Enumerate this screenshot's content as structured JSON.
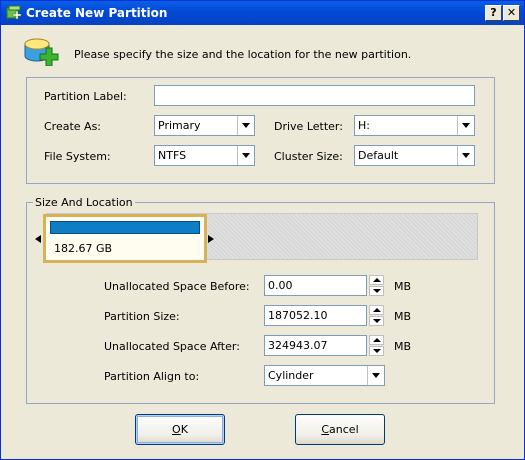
{
  "window": {
    "title": "Create New Partition",
    "help_label": "?",
    "close_label": "✕"
  },
  "header": {
    "text": "Please specify the size and the location for the new partition."
  },
  "form": {
    "partition_label": {
      "label": "Partition Label:",
      "value": ""
    },
    "create_as": {
      "label": "Create As:",
      "value": "Primary"
    },
    "drive_letter": {
      "label": "Drive Letter:",
      "value": "H:"
    },
    "file_system": {
      "label": "File System:",
      "value": "NTFS"
    },
    "cluster_size": {
      "label": "Cluster Size:",
      "value": "Default"
    }
  },
  "size_location": {
    "title": "Size And Location",
    "partition_size_display": "182.67 GB",
    "unallocated_before": {
      "label": "Unallocated Space Before:",
      "value": "0.00",
      "unit": "MB"
    },
    "partition_size": {
      "label": "Partition Size:",
      "value": "187052.10",
      "unit": "MB"
    },
    "unallocated_after": {
      "label": "Unallocated Space After:",
      "value": "324943.07",
      "unit": "MB"
    },
    "align": {
      "label": "Partition Align to:",
      "value": "Cylinder"
    }
  },
  "buttons": {
    "ok": {
      "mnemonic": "O",
      "rest": "K"
    },
    "cancel": {
      "mnemonic": "C",
      "rest": "ancel"
    }
  },
  "colors": {
    "titlebar": "#0054e3",
    "partition_bar": "#0e7dc5",
    "selection_border": "#d8b25a"
  }
}
